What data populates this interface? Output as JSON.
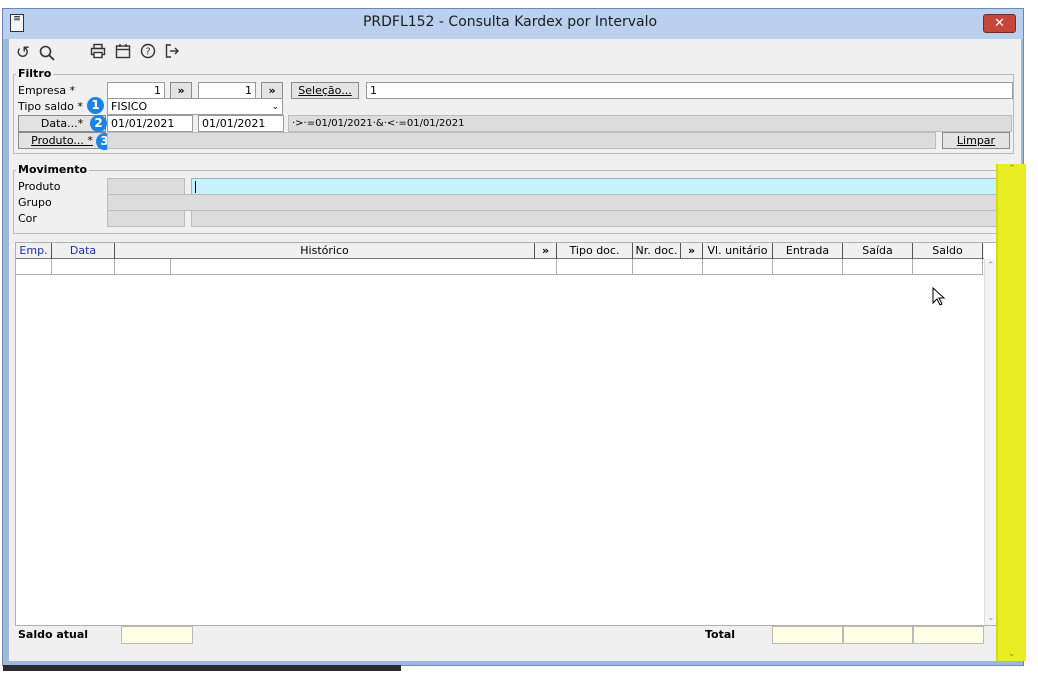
{
  "window": {
    "title": "PRDFL152 - Consulta Kardex por Intervalo",
    "close_glyph": "✕"
  },
  "toolbar": {
    "icons": [
      "undo-icon",
      "search-icon",
      "print-icon",
      "calendar-icon",
      "help-icon",
      "exit-icon"
    ],
    "glyphs": [
      "↺",
      "🔍",
      "🖶",
      "📅",
      "?",
      "↦"
    ]
  },
  "filtro": {
    "label": "Filtro",
    "empresa_label": "Empresa *",
    "empresa_from": "1",
    "empresa_to": "1",
    "more_glyph": "»",
    "selecao_button": "Seleção...",
    "selecao_value": "1",
    "tipo_saldo_label": "Tipo saldo *",
    "tipo_saldo_value": "FISICO",
    "data_button": "Data...*",
    "data_from": "01/01/2021",
    "data_to": "01/01/2021",
    "data_expr": "·>·=01/01/2021·&·<·=01/01/2021",
    "produto_button": "Produto... *",
    "limpar_button": "Limpar",
    "badges": [
      "1",
      "2",
      "3"
    ]
  },
  "movimento": {
    "label": "Movimento",
    "produto_label": "Produto",
    "grupo_label": "Grupo",
    "cor_label": "Cor"
  },
  "grid": {
    "columns": [
      "Emp.",
      "Data",
      "Histórico",
      "»",
      "Tipo doc.",
      "Nr. doc.",
      "»",
      "Vl. unitário",
      "Entrada",
      "Saída",
      "Saldo"
    ]
  },
  "footer": {
    "saldo_atual_label": "Saldo atual",
    "total_label": "Total"
  },
  "colors": {
    "highlight": "#e8ee22",
    "focus_input": "#c6f3fb",
    "badge": "#1b83e6"
  }
}
